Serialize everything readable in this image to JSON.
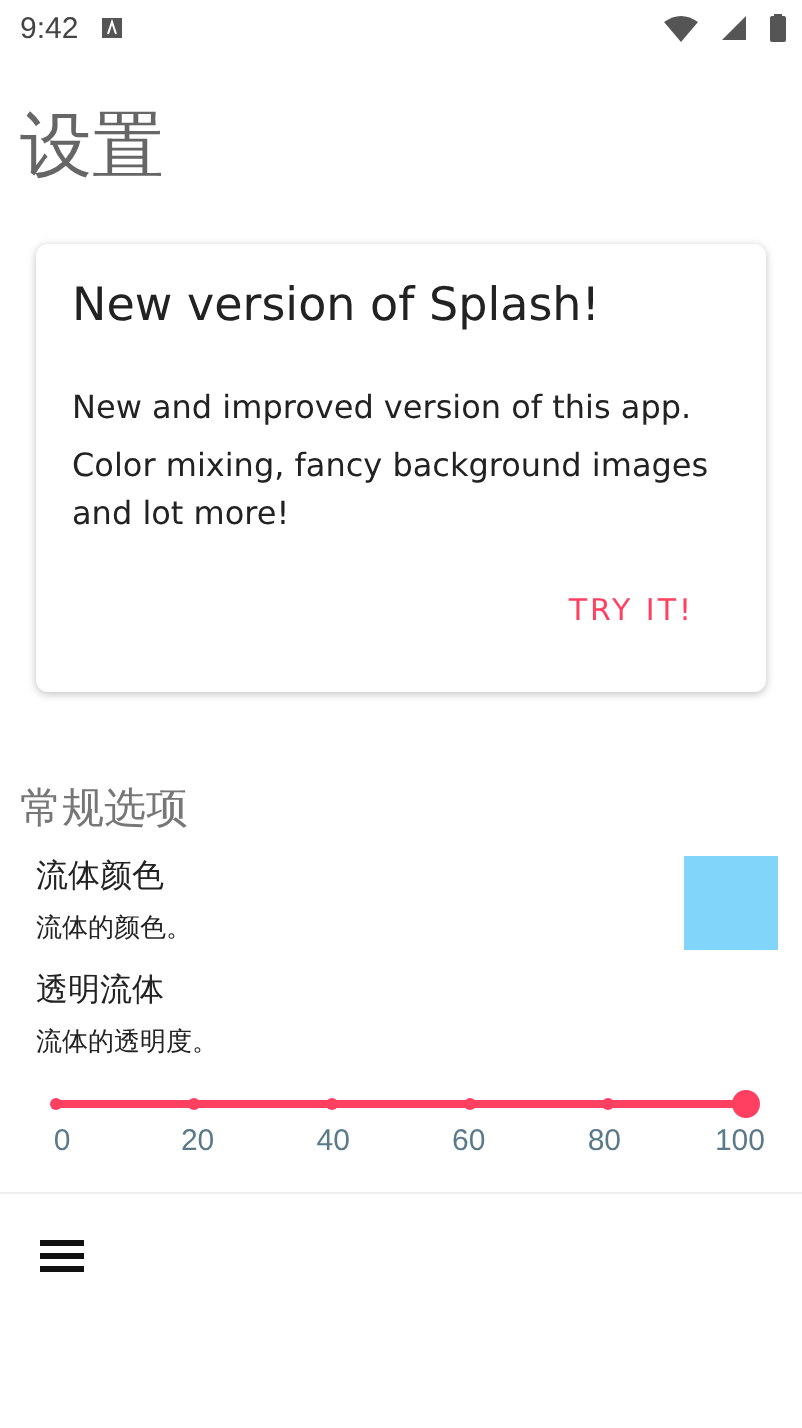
{
  "status_bar": {
    "time": "9:42"
  },
  "title": "设置",
  "card": {
    "title": "New version of Splash!",
    "body": [
      "New and improved version of this app.",
      "Color mixing, fancy background images and lot more!"
    ],
    "action": "TRY IT!"
  },
  "section": {
    "title": "常规选项",
    "items": [
      {
        "kind": "color",
        "title": "流体颜色",
        "summary": "流体的颜色。",
        "color": "#81d4fa"
      },
      {
        "kind": "slider",
        "title": "透明流体",
        "summary": "流体的透明度。",
        "level": 1,
        "ticks": [
          "0",
          "20",
          "40",
          "60",
          "80",
          "100"
        ]
      }
    ]
  }
}
